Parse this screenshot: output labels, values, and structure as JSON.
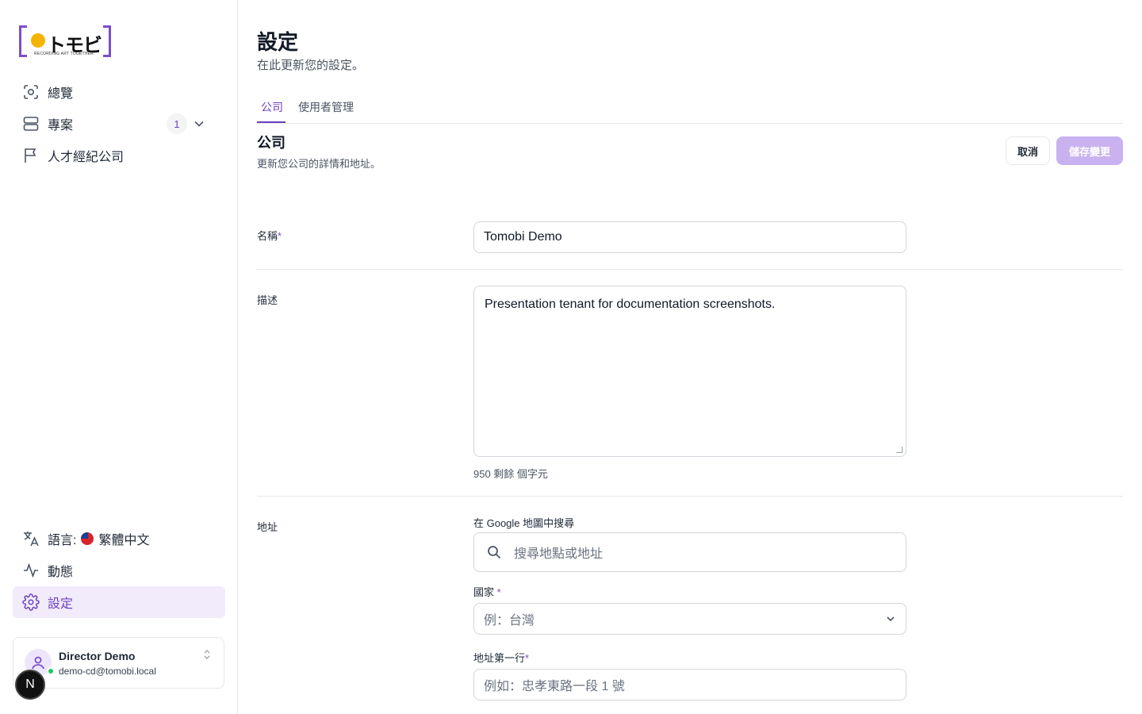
{
  "brand": {
    "wordmark": "トモビ",
    "tagline": "RECORDING ART TOGETHER"
  },
  "sidebar": {
    "nav": [
      {
        "label": "總覽",
        "icon": "overview-icon"
      },
      {
        "label": "專案",
        "icon": "projects-icon",
        "badge": "1"
      },
      {
        "label": "人才經紀公司",
        "icon": "flag-icon"
      }
    ],
    "bottom": {
      "language_label": "語言:",
      "language_value": "繁體中文",
      "activity_label": "動態",
      "settings_label": "設定"
    },
    "user": {
      "name": "Director Demo",
      "email": "demo-cd@tomobi.local"
    },
    "dev_badge": "N"
  },
  "header": {
    "title": "設定",
    "subtitle": "在此更新您的設定。"
  },
  "tabs": [
    {
      "label": "公司",
      "active": true
    },
    {
      "label": "使用者管理",
      "active": false
    }
  ],
  "section": {
    "title": "公司",
    "subtitle": "更新您公司的詳情和地址。",
    "cancel_label": "取消",
    "save_label": "儲存變更"
  },
  "form": {
    "name_label": "名稱",
    "name_value": "Tomobi Demo",
    "description_label": "描述",
    "description_value": "Presentation tenant for documentation screenshots.",
    "counter": "950 剩餘 個字元",
    "address_label": "地址",
    "google_search_label": "在 Google 地圖中搜尋",
    "google_search_placeholder": "搜尋地點或地址",
    "country_label": "國家",
    "country_placeholder": "例：台灣",
    "address_line1_label": "地址第一行",
    "address_line1_placeholder": "例如：忠孝東路一段 1 號",
    "required_mark": "*"
  },
  "colors": {
    "accent": "#6d3fc0",
    "accent_bg": "#f1ebfb",
    "save_disabled": "#c9b2ef",
    "logo_dot": "#f5b400"
  }
}
